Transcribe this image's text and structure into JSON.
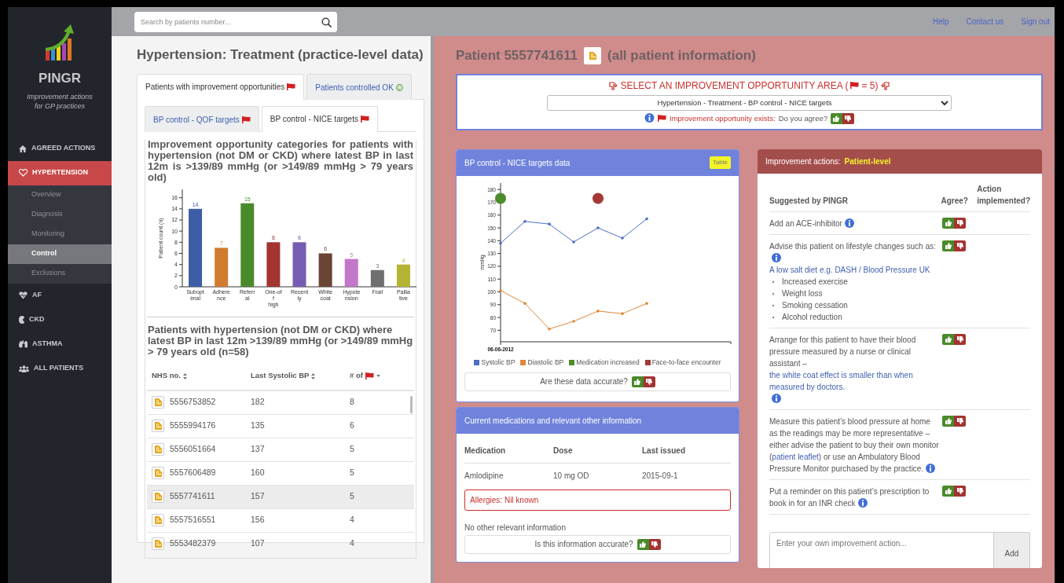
{
  "sidebar": {
    "app_name": "PINGR",
    "tagline_lines": [
      "Improvement actions",
      "for GP practices"
    ],
    "items": [
      {
        "label": "AGREED ACTIONS",
        "selected": false
      },
      {
        "label": "HYPERTENSION",
        "selected": true,
        "children": [
          {
            "label": "Overview",
            "selected": false
          },
          {
            "label": "Diagnosis",
            "selected": false
          },
          {
            "label": "Monitoring",
            "selected": false
          },
          {
            "label": "Control",
            "selected": true
          },
          {
            "label": "Exclusions",
            "selected": false
          }
        ]
      },
      {
        "label": "AF",
        "selected": false
      },
      {
        "label": "CKD",
        "selected": false
      },
      {
        "label": "ASTHMA",
        "selected": false
      },
      {
        "label": "ALL PATIENTS",
        "selected": false
      }
    ]
  },
  "top_bar": {
    "search": {
      "placeholder": "Search by patients number..."
    },
    "links": [
      "Help",
      "Contact us",
      "Sign out"
    ]
  },
  "practice_panel": {
    "title": "Hypertension: Treatment (practice-level data)",
    "tabs": [
      {
        "label": "Patients with improvement opportunities",
        "selected": true,
        "kind": "flag"
      },
      {
        "label": "Patients controlled OK",
        "selected": false,
        "kind": "smile"
      }
    ],
    "subtabs": [
      {
        "label": "BP control - QOF targets",
        "selected": false,
        "kind": "flag"
      },
      {
        "label": "BP control - NICE targets",
        "selected": true,
        "kind": "flag"
      }
    ],
    "chart_title": "Improvement opportunity categories for patients with hypertension (not DM or CKD) where latest BP in last 12m is >139/89 mmHg (or >149/89 mmHg > 79 years old)",
    "chart_data": {
      "type": "bar",
      "ylabel": "Patient count (n)",
      "categories": [
        "Subopt imal",
        "Adhere nce",
        "Referr al",
        "One-of f high",
        "Recent ly",
        "White coat",
        "Hypote nsion",
        "Frail",
        "Pallia tive"
      ],
      "series": [
        {
          "values": [
            14,
            7,
            15,
            8,
            8,
            6,
            5,
            3,
            4
          ]
        }
      ],
      "colors": [
        "#3d5ea6",
        "#d17b2f",
        "#4b8a2a",
        "#a33432",
        "#775cb3",
        "#6a4434",
        "#c277c8",
        "#6f6f6f",
        "#b4b432"
      ],
      "ylim": [
        0,
        17.5
      ],
      "yticks": [
        0,
        2,
        4,
        6,
        8,
        10,
        12,
        14,
        16
      ],
      "data_labels": true
    },
    "table_title": "Patients with hypertension (not DM or CKD) where latest BP in last 12m >139/89 mmHg (or >149/89 mmHg > 79 years old (n=58)",
    "table": {
      "columns": [
        {
          "label": "NHS no.",
          "kind": "text",
          "sorted": false
        },
        {
          "label": "Last Systolic BP",
          "kind": "text",
          "sorted": false
        },
        {
          "label": "# of",
          "kind": "flag",
          "sorted": true
        }
      ],
      "rows": [
        {
          "nhs_no": "5556753852",
          "last_systolic_bp": "182",
          "flags": "8",
          "selected": false
        },
        {
          "nhs_no": "5555994176",
          "last_systolic_bp": "135",
          "flags": "6",
          "selected": false
        },
        {
          "nhs_no": "5556051664",
          "last_systolic_bp": "137",
          "flags": "5",
          "selected": false
        },
        {
          "nhs_no": "5557606489",
          "last_systolic_bp": "160",
          "flags": "5",
          "selected": false
        },
        {
          "nhs_no": "5557741611",
          "last_systolic_bp": "157",
          "flags": "5",
          "selected": true
        },
        {
          "nhs_no": "5557516551",
          "last_systolic_bp": "156",
          "flags": "4",
          "selected": false
        },
        {
          "nhs_no": "5553482379",
          "last_systolic_bp": "107",
          "flags": "4",
          "selected": false
        }
      ]
    }
  },
  "patient_panel": {
    "title": "Patient 5557741611",
    "subtitle": "(all patient information)",
    "opportunity": {
      "heading_before": "SELECT AN IMPROVEMENT OPPORTUNITY AREA (",
      "heading_after": "= 5)",
      "selected_area": "Hypertension - Treatment - BP control - NICE targets",
      "exists_text": "Improvement opportunity exists:",
      "question": "Do you agree?"
    },
    "bp_card": {
      "title": "BP control - NICE targets data",
      "badge": "Table",
      "chart_data": {
        "type": "line",
        "ylabel": "mmHg",
        "ylim": [
          61,
          185
        ],
        "yticks": [
          70,
          80,
          90,
          100,
          110,
          120,
          130,
          140,
          150,
          160,
          170,
          180
        ],
        "series": [
          {
            "name": "Systolic BP",
            "color": "#4a6fc4",
            "marker": true,
            "values": [
              138,
              155,
              153,
              139,
              150,
              142,
              157
            ]
          },
          {
            "name": "Diastolic BP",
            "color": "#e0883a",
            "marker": true,
            "values": [
              101,
              91,
              71,
              77,
              85,
              83,
              91
            ]
          },
          {
            "name": "Medication increased",
            "color": "#4c8c2b",
            "marker": true,
            "values": [
              173,
              null,
              null,
              null,
              null,
              null,
              null
            ]
          },
          {
            "name": "Face-to-face encounter",
            "color": "#a33a36",
            "marker": true,
            "values": [
              null,
              null,
              null,
              null,
              173,
              null,
              null
            ]
          }
        ],
        "annotations": [
          "06-06-2012"
        ]
      },
      "question": "Are these data accurate?"
    },
    "medications_card": {
      "title": "Current medications and relevant other information",
      "columns": [
        "Medication",
        "Dose",
        "Last issued"
      ],
      "rows": [
        [
          "Amlodipine",
          "10 mg OD",
          "2015-09-1"
        ]
      ],
      "allergies": "Allergies: Nil known",
      "note": "No other relevant information",
      "question": "Is this information accurate?"
    },
    "actions_card": {
      "title": "Improvement actions:",
      "level": "Patient-level",
      "columns": [
        "Suggested by PINGR",
        "Agree?",
        "Action implemented?"
      ],
      "rows": [
        {
          "parts": [
            {
              "kind": "text",
              "text": "Add an ACE-inhibitor"
            },
            {
              "kind": "info"
            }
          ]
        },
        {
          "parts": [
            {
              "kind": "text",
              "text": "Advise this patient on lifestyle changes such as:"
            },
            {
              "kind": "info"
            },
            {
              "kind": "link",
              "text": "A low salt diet e.g. DASH / Blood Pressure UK"
            }
          ],
          "bullets": [
            "Increased exercise",
            "Weight loss",
            "Smoking cessation",
            "Alcohol reduction"
          ]
        },
        {
          "parts": [
            {
              "kind": "text",
              "text": "Arrange for this patient to have their blood pressure measured by a nurse or clinical assistant – "
            },
            {
              "kind": "link",
              "text": "the white coat effect is smaller than when measured by doctors."
            },
            {
              "kind": "info"
            }
          ]
        },
        {
          "parts": [
            {
              "kind": "text",
              "text": "Measure this patient’s blood pressure at home as the readings may be more representative – either advise the patient to buy their own monitor ("
            },
            {
              "kind": "link",
              "text": "patient leaflet"
            },
            {
              "kind": "text",
              "text": ") or use an Ambulatory Blood Pressure Monitor purchased by the practice."
            },
            {
              "kind": "info"
            }
          ]
        },
        {
          "parts": [
            {
              "kind": "text",
              "text": "Put a reminder on this patient’s prescription to book in for an INR check"
            },
            {
              "kind": "info"
            }
          ]
        }
      ],
      "input": {
        "placeholder": "Enter your own improvement action..."
      },
      "add_button": "Add"
    }
  }
}
